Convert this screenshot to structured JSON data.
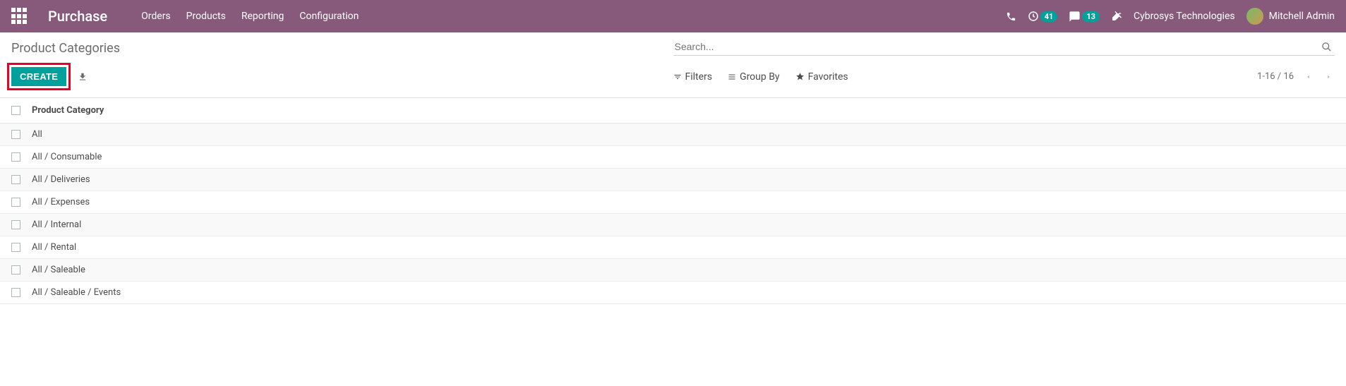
{
  "navbar": {
    "brand": "Purchase",
    "menu": [
      "Orders",
      "Products",
      "Reporting",
      "Configuration"
    ],
    "activity_badge": "41",
    "messages_badge": "13",
    "company": "Cybrosys Technologies",
    "user": "Mitchell Admin"
  },
  "breadcrumb": "Product Categories",
  "search": {
    "placeholder": "Search..."
  },
  "buttons": {
    "create": "CREATE"
  },
  "searchopts": {
    "filters": "Filters",
    "groupby": "Group By",
    "favorites": "Favorites"
  },
  "pager": {
    "range": "1-16 / 16"
  },
  "table": {
    "header": "Product Category",
    "rows": [
      "All",
      "All / Consumable",
      "All / Deliveries",
      "All / Expenses",
      "All / Internal",
      "All / Rental",
      "All / Saleable",
      "All / Saleable / Events"
    ]
  }
}
